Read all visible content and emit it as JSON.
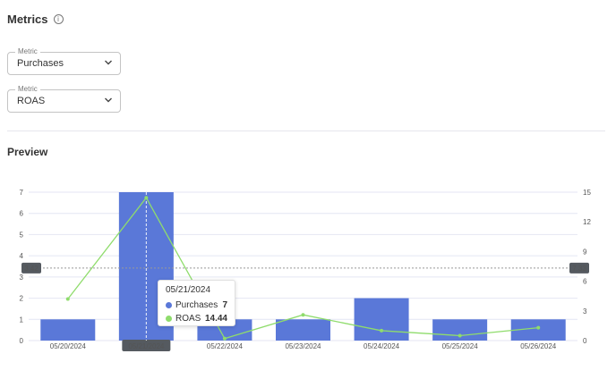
{
  "header": {
    "title": "Metrics",
    "info_icon": "info-icon"
  },
  "metric_selects": [
    {
      "label": "Metric",
      "value": "Purchases"
    },
    {
      "label": "Metric",
      "value": "ROAS"
    }
  ],
  "preview": {
    "title": "Preview"
  },
  "colors": {
    "bar": "#5a78d8",
    "line": "#8fdc6c",
    "grid": "#e4e6f3",
    "crosshair_label_bg": "#555a60"
  },
  "crosshair": {
    "left_value": "3.42",
    "right_value": "7.33",
    "highlight_category": "05/21/2024"
  },
  "tooltip": {
    "date": "05/21/2024",
    "rows": [
      {
        "name": "Purchases",
        "value": "7",
        "color": "#5a78d8"
      },
      {
        "name": "ROAS",
        "value": "14.44",
        "color": "#8fdc6c"
      }
    ]
  },
  "chart_data": {
    "type": "bar",
    "categories": [
      "05/20/2024",
      "05/21/2024",
      "05/22/2024",
      "05/23/2024",
      "05/24/2024",
      "05/25/2024",
      "05/26/2024"
    ],
    "series": [
      {
        "name": "Purchases",
        "type": "bar",
        "axis": "left",
        "values": [
          1,
          7,
          1,
          1,
          2,
          1,
          1
        ]
      },
      {
        "name": "ROAS",
        "type": "line",
        "axis": "right",
        "values": [
          4.2,
          14.44,
          0.2,
          2.6,
          1.0,
          0.5,
          1.3
        ]
      }
    ],
    "y_left": {
      "ylim": [
        0,
        7
      ],
      "ticks": [
        "0",
        "1",
        "2",
        "3",
        "4",
        "5",
        "6",
        "7"
      ]
    },
    "y_right": {
      "ylim": [
        0,
        15
      ],
      "ticks": [
        "0",
        "3",
        "6",
        "9",
        "12",
        "15"
      ]
    },
    "grid": true
  }
}
